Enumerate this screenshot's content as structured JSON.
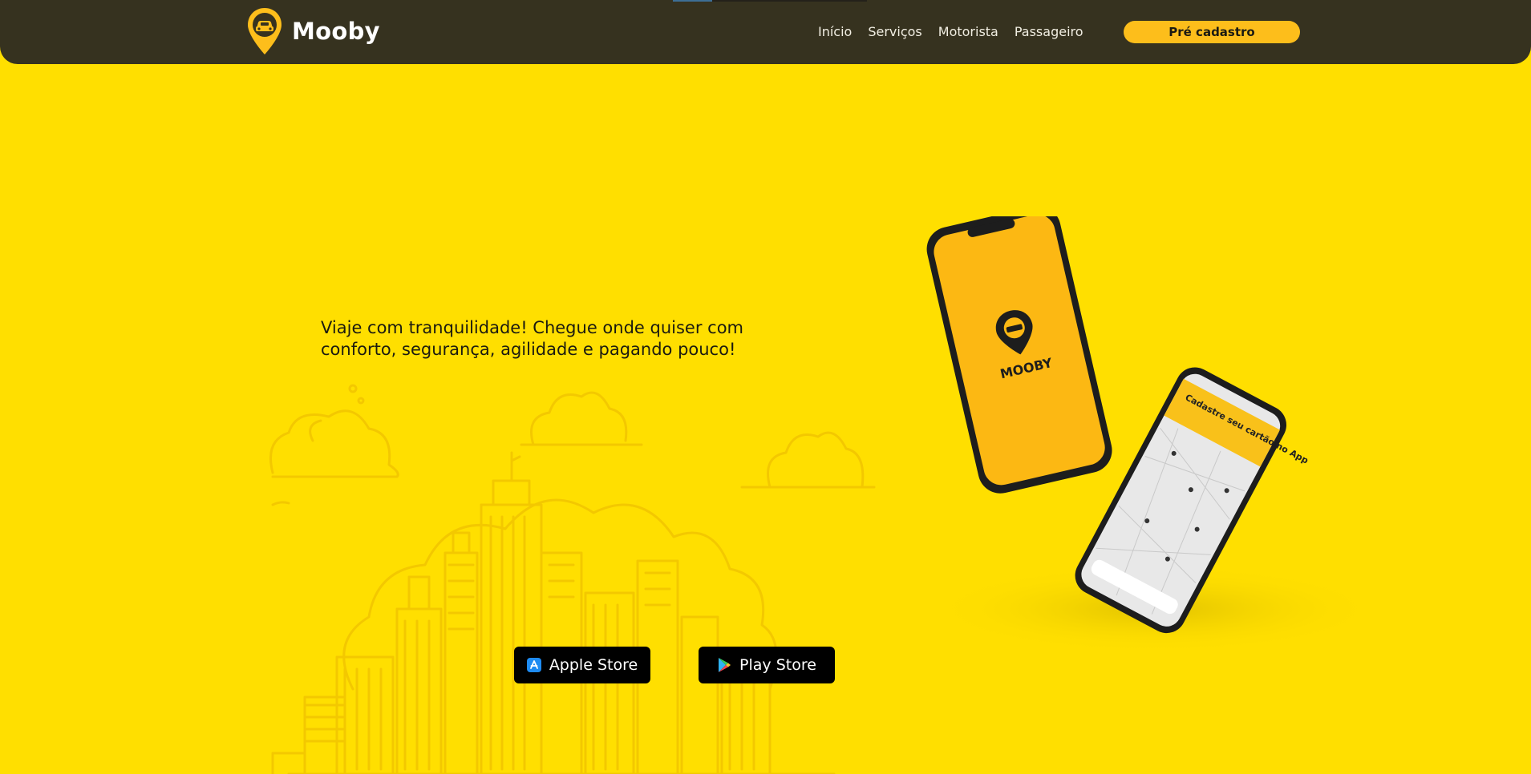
{
  "brand": {
    "name": "Mooby",
    "colors": {
      "header": "#36321F",
      "background": "#FFDF00",
      "accent": "#FDBE1B"
    }
  },
  "nav": {
    "items": [
      {
        "label": "Início"
      },
      {
        "label": "Serviços"
      },
      {
        "label": "Motorista"
      },
      {
        "label": "Passageiro"
      }
    ]
  },
  "cta": {
    "label": "Pré cadastro"
  },
  "hero": {
    "headline": "Viaje com tranquilidade! Chegue onde quiser com conforto, segurança, agilidade e pagando pouco!"
  },
  "stores": {
    "apple": {
      "label": "Apple Store",
      "icon": "app-store-icon"
    },
    "play": {
      "label": "Play Store",
      "icon": "google-play-icon"
    }
  },
  "phone_screen": {
    "logo_text": "MOOBY",
    "banner_text": "Cadastre seu cartão no App"
  }
}
